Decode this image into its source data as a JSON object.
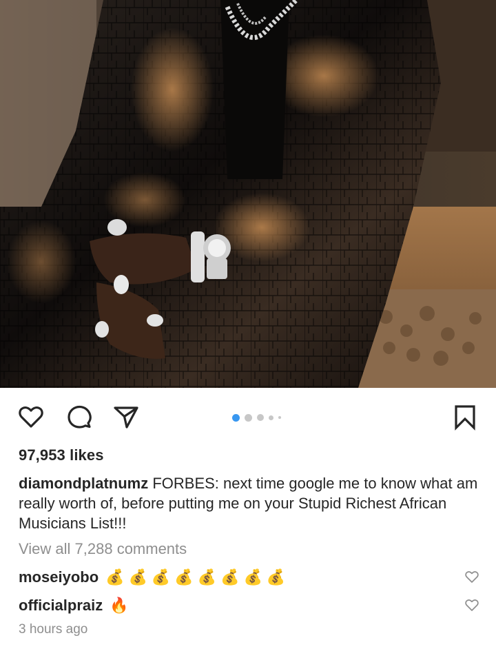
{
  "post": {
    "image_alt": "Man in glossy black crocodile leather suit with diamond jewelry seated on a wooden bench",
    "likes_text": "97,953 likes",
    "caption_user": "diamondplatnumz",
    "caption_text": " FORBES: next time google me to know what am really worth of, before putting me on your Stupid Richest African Musicians List!!!",
    "view_comments_text": "View all 7,288 comments",
    "timestamp": "3 hours ago"
  },
  "carousel": {
    "total": 5,
    "active_index": 0,
    "active_color": "#3897f0",
    "inactive_color": "#c7c7c7"
  },
  "actions": {
    "like_icon": "heart-outline-icon",
    "comment_icon": "speech-bubble-icon",
    "share_icon": "paper-plane-icon",
    "save_icon": "bookmark-icon"
  },
  "comments": [
    {
      "user": "moseiyobo",
      "text": "💰💰💰💰💰💰💰💰"
    },
    {
      "user": "officialpraiz",
      "text": "🔥"
    }
  ],
  "colors": {
    "text": "#262626",
    "muted": "#8e8e8e",
    "accent": "#3897f0"
  }
}
